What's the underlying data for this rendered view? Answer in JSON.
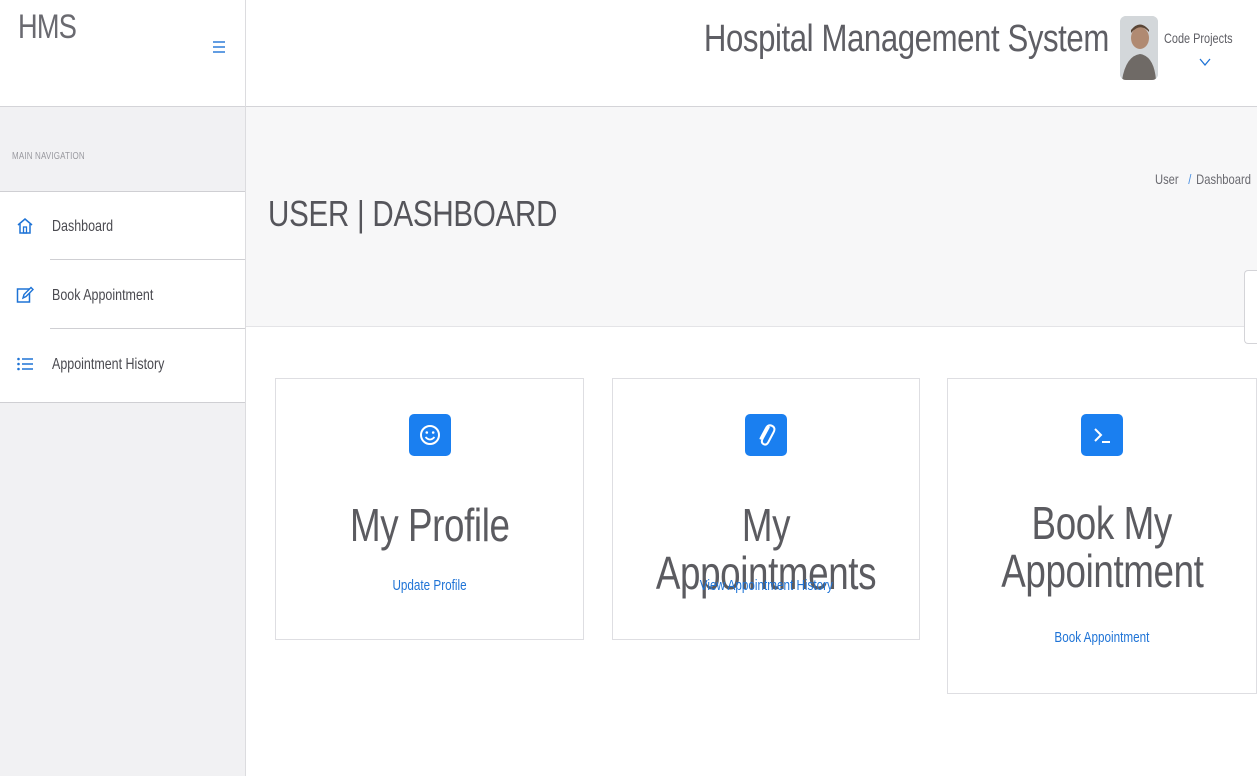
{
  "brand": {
    "name": "HMS"
  },
  "sidebar": {
    "heading": "MAIN NAVIGATION",
    "items": [
      {
        "label": "Dashboard",
        "icon": "home-icon"
      },
      {
        "label": "Book Appointment",
        "icon": "pencil-square-icon"
      },
      {
        "label": "Appointment History",
        "icon": "list-icon"
      }
    ]
  },
  "header": {
    "system_title": "Hospital Management System",
    "user_name": "Code Projects"
  },
  "page": {
    "title": "USER | DASHBOARD",
    "breadcrumb": [
      "User",
      "Dashboard"
    ]
  },
  "cards": [
    {
      "title": "My Profile",
      "link": "Update Profile",
      "icon": "smiley-icon"
    },
    {
      "title": "My Appointments",
      "link": "View Appointment History",
      "icon": "paperclip-icon"
    },
    {
      "title_lines": [
        "Book My",
        "Appointment"
      ],
      "link": "Book Appointment",
      "icon": "terminal-icon"
    }
  ],
  "colors": {
    "accent": "#1a7ff0",
    "link": "#1e73d6",
    "sidebar_bg": "#f1f1f3",
    "title_area_bg": "#f7f7f8"
  }
}
